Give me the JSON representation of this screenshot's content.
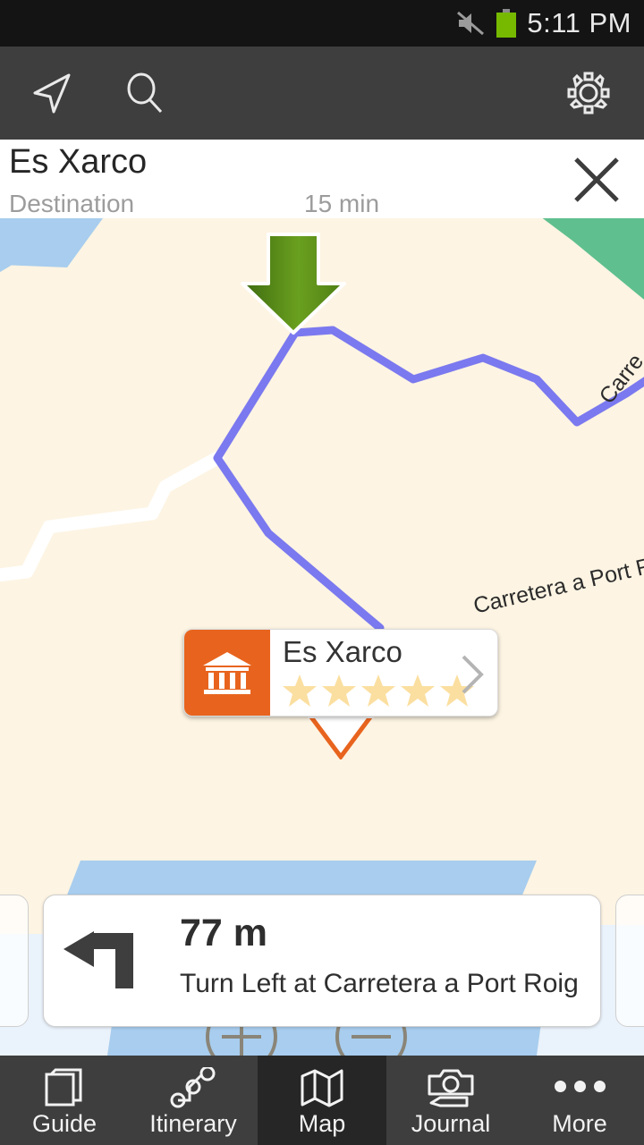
{
  "statusbar": {
    "time": "5:11 PM",
    "mute_icon": "mute-icon",
    "battery_icon": "battery-icon"
  },
  "toolbar": {
    "navigate_icon": "navigate-arrow-icon",
    "search_icon": "search-icon",
    "settings_icon": "gear-icon"
  },
  "destination_header": {
    "title": "Es Xarco",
    "subtitle": "Destination",
    "eta": "15 min",
    "close_icon": "close-icon"
  },
  "map": {
    "land_color": "#fdf4e3",
    "water_color": "#a8cdee",
    "park_color": "#5fbf8f",
    "route_color": "#7b79ef",
    "road_color": "#ffffff",
    "position_marker_icon": "green-down-arrow-marker",
    "labels": [
      {
        "text": "Carretera a Port Roig"
      },
      {
        "text": "Carre"
      }
    ],
    "zoom_in_label": "zoom-in",
    "zoom_out_label": "zoom-out"
  },
  "callout": {
    "name": "Es Xarco",
    "category_icon": "museum-icon",
    "icon_bg": "#e8641e",
    "rating": 5,
    "star_color": "#fbdfa0",
    "chevron_icon": "chevron-right-icon"
  },
  "turn_card": {
    "distance": "77 m",
    "instruction": "Turn Left at Carretera a Port Roig",
    "maneuver_icon": "turn-left-arrow-icon"
  },
  "bottom_nav": {
    "active": "Map",
    "items": [
      {
        "label": "Guide",
        "icon": "book-icon"
      },
      {
        "label": "Itinerary",
        "icon": "route-nodes-icon"
      },
      {
        "label": "Map",
        "icon": "folded-map-icon"
      },
      {
        "label": "Journal",
        "icon": "camera-pencil-icon"
      },
      {
        "label": "More",
        "icon": "ellipsis-icon"
      }
    ]
  }
}
